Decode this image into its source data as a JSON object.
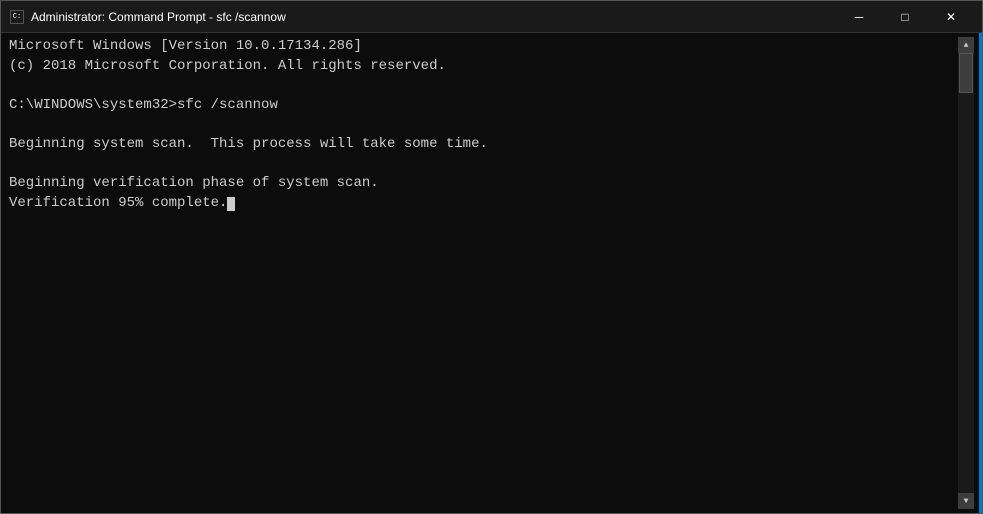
{
  "window": {
    "title": "Administrator: Command Prompt - sfc /scannow",
    "icon": "cmd-icon"
  },
  "titlebar": {
    "minimize_label": "─",
    "maximize_label": "□",
    "close_label": "✕"
  },
  "terminal": {
    "lines": [
      "Microsoft Windows [Version 10.0.17134.286]",
      "(c) 2018 Microsoft Corporation. All rights reserved.",
      "",
      "C:\\WINDOWS\\system32>sfc /scannow",
      "",
      "Beginning system scan.  This process will take some time.",
      "",
      "Beginning verification phase of system scan.",
      "Verification 95% complete."
    ]
  }
}
